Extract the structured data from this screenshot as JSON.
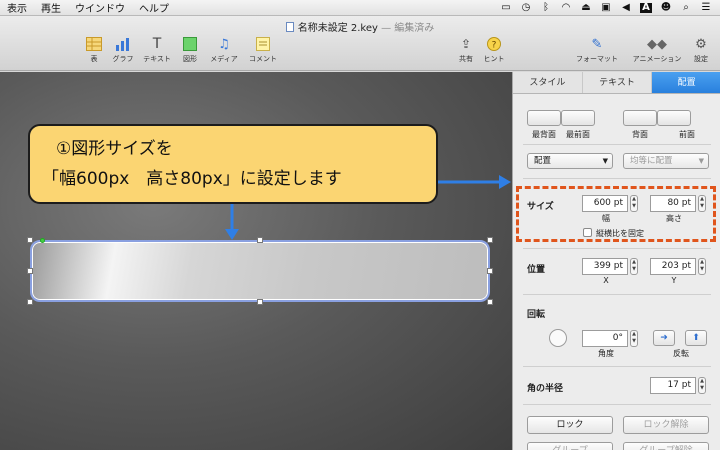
{
  "menubar": {
    "items": [
      "表示",
      "再生",
      "ウインドウ",
      "ヘルプ"
    ]
  },
  "document": {
    "title": "名称未設定 2.key",
    "edited": " — 編集済み"
  },
  "toolbar": {
    "table": "表",
    "chart": "グラフ",
    "text": "テキスト",
    "shape": "図形",
    "media": "メディア",
    "comment": "コメント",
    "share": "共有",
    "tips": "ヒント",
    "format": "フォーマット",
    "animate": "アニメーション",
    "settings": "設定"
  },
  "callout": {
    "line1": "①図形サイズを",
    "line2": "「幅600px　高さ80px」に設定します"
  },
  "inspector": {
    "tabs": [
      "スタイル",
      "テキスト",
      "配置"
    ],
    "active_tab": "配置",
    "arrange": {
      "labels": [
        "最背面",
        "最前面",
        "背面",
        "前面"
      ]
    },
    "align_dropdown": "配置",
    "distribute_dropdown": "均等に配置",
    "size": {
      "label": "サイズ",
      "width": "600 pt",
      "height": "80 pt",
      "width_label": "幅",
      "height_label": "高さ",
      "constrain": "縦横比を固定"
    },
    "position": {
      "label": "位置",
      "x": "399 pt",
      "y": "203 pt",
      "x_label": "X",
      "y_label": "Y"
    },
    "rotate": {
      "label": "回転",
      "angle": "0°",
      "angle_label": "角度",
      "flip_label": "反転"
    },
    "corner": {
      "label": "角の半径",
      "value": "17 pt"
    },
    "lock": "ロック",
    "unlock": "ロック解除",
    "group": "グループ",
    "ungroup": "グループ解除"
  },
  "colors": {
    "callout_bg": "#fbd572",
    "highlight": "#e0551c",
    "arrow": "#2f7fe6",
    "tab_active": "#2980dd"
  }
}
